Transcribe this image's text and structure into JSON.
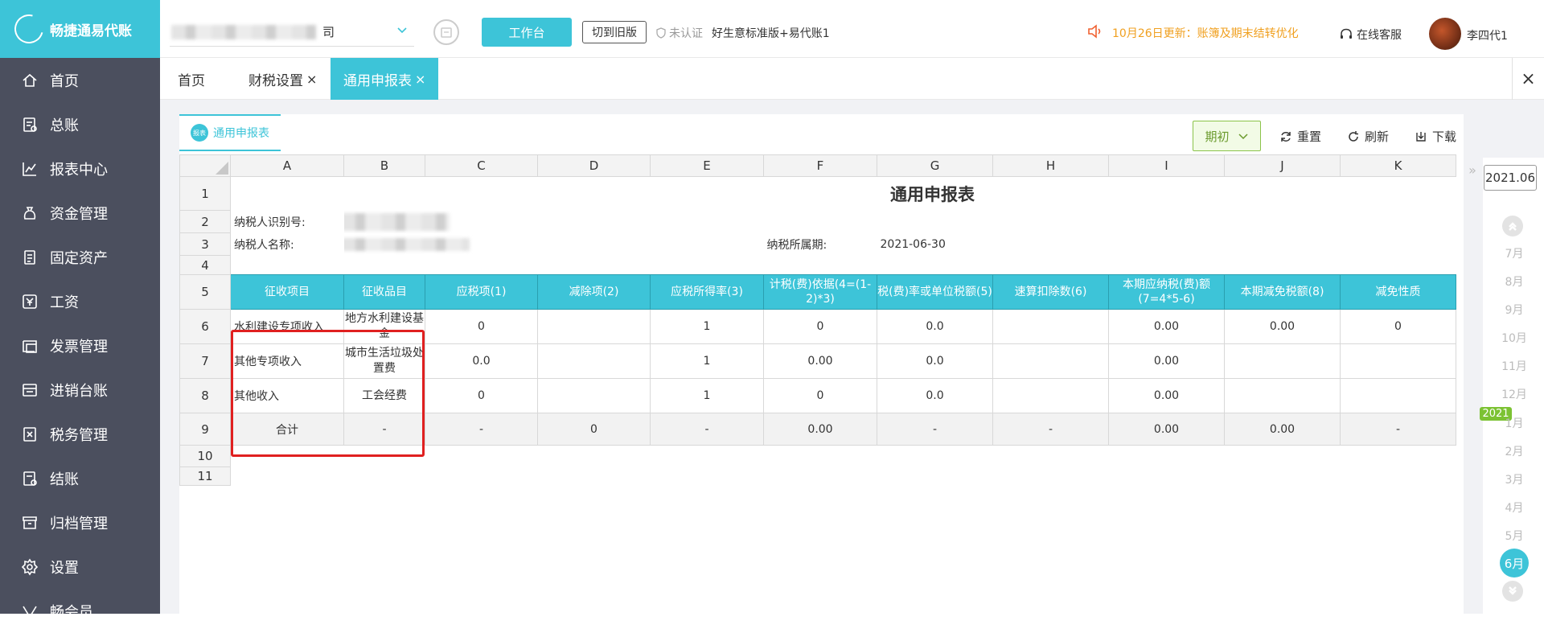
{
  "app": {
    "logo_text": "畅捷通易代账"
  },
  "sidebar": {
    "items": [
      {
        "label": "首页",
        "icon": "home-icon"
      },
      {
        "label": "总账",
        "icon": "ledger-icon"
      },
      {
        "label": "报表中心",
        "icon": "report-chart-icon"
      },
      {
        "label": "资金管理",
        "icon": "money-bag-icon"
      },
      {
        "label": "固定资产",
        "icon": "asset-icon"
      },
      {
        "label": "工资",
        "icon": "salary-icon"
      },
      {
        "label": "发票管理",
        "icon": "invoice-icon"
      },
      {
        "label": "进销台账",
        "icon": "inventory-icon"
      },
      {
        "label": "税务管理",
        "icon": "tax-icon"
      },
      {
        "label": "结账",
        "icon": "checkout-icon"
      },
      {
        "label": "归档管理",
        "icon": "archive-icon"
      },
      {
        "label": "设置",
        "icon": "gear-icon"
      },
      {
        "label": "畅会员",
        "icon": "vip-icon"
      }
    ]
  },
  "topbar": {
    "company_suffix": "司",
    "workbench_label": "工作台",
    "switch_old_label": "切到旧版",
    "cert_label": "未认证",
    "edition_label": "好生意标准版+易代账1",
    "update_notice": "10月26日更新：账簿及期末结转优化",
    "service_label": "在线客服",
    "user_name": "李四代1",
    "accent_color": "#3dc4d8",
    "notice_color": "#f0a020"
  },
  "tabs": [
    {
      "label": "首页",
      "closable": false
    },
    {
      "label": "财税设置",
      "closable": true,
      "close": "×"
    },
    {
      "label": "通用申报表",
      "closable": true,
      "active": true,
      "close": "×"
    }
  ],
  "close_all": "×",
  "report": {
    "subtab_label": "通用申报表",
    "subtab_icon_text": "报表",
    "period_button": "期初",
    "reset_label": "重置",
    "refresh_label": "刷新",
    "download_label": "下载",
    "columns": [
      "A",
      "B",
      "C",
      "D",
      "E",
      "F",
      "G",
      "H",
      "I",
      "J",
      "K"
    ],
    "rows": [
      "1",
      "2",
      "3",
      "4",
      "5",
      "6",
      "7",
      "8",
      "9",
      "10",
      "11"
    ],
    "title": "通用申报表",
    "taxpayer_id_label": "纳税人识别号:",
    "taxpayer_name_label": "纳税人名称:",
    "period_label": "纳税所属期:",
    "period_value": "2021-06-30",
    "headers": [
      "征收项目",
      "征收品目",
      "应税项(1)",
      "减除项(2)",
      "应税所得率(3)",
      "计税(费)依据(4=(1-2)*3)",
      "税(费)率或单位税额(5)",
      "速算扣除数(6)",
      "本期应纳税(费)额(7=4*5-6)",
      "本期减免税额(8)",
      "减免性质"
    ],
    "data_rows": [
      [
        "水利建设专项收入",
        "地方水利建设基金",
        "0",
        "",
        "1",
        "0",
        "0.0",
        "",
        "0.00",
        "0.00",
        "0"
      ],
      [
        "其他专项收入",
        "城市生活垃圾处置费",
        "0.0",
        "",
        "1",
        "0.00",
        "0.0",
        "",
        "0.00",
        "",
        ""
      ],
      [
        "其他收入",
        "工会经费",
        "0",
        "",
        "1",
        "0",
        "0.0",
        "",
        "0.00",
        "",
        ""
      ]
    ],
    "total_row": [
      "合计",
      "-",
      "-",
      "0",
      "-",
      "0.00",
      "-",
      "-",
      "0.00",
      "0.00",
      "-"
    ]
  },
  "period_rail": {
    "current": "2021.06",
    "months_before": [
      "7月",
      "8月",
      "9月",
      "10月",
      "11月",
      "12月"
    ],
    "year_badge": "2021",
    "months_after": [
      "1月",
      "2月",
      "3月",
      "4月",
      "5月"
    ],
    "current_month": "6月"
  }
}
